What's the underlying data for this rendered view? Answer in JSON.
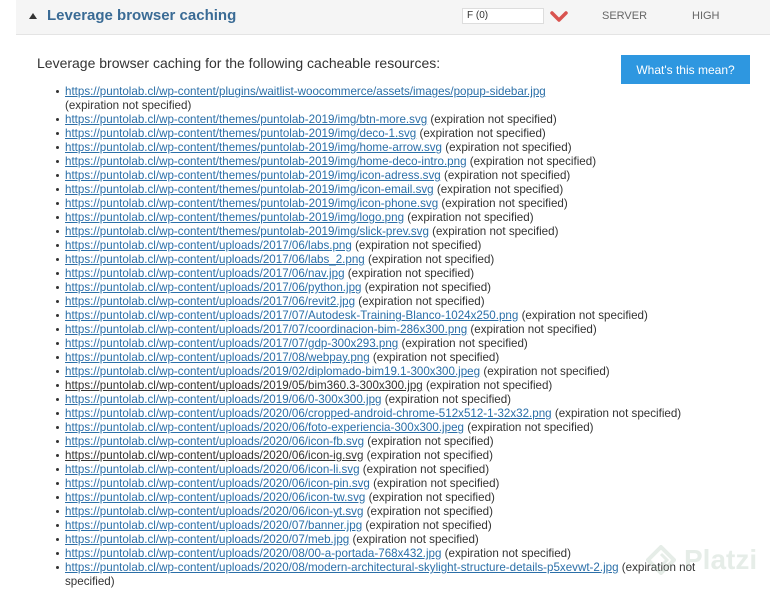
{
  "header": {
    "title": "Leverage browser caching",
    "grade": "F (0)",
    "type": "SERVER",
    "priority": "HIGH",
    "heart_color": "#d9534f"
  },
  "intro": "Leverage browser caching for the following cacheable resources:",
  "help_button": "What's this mean?",
  "resources": [
    {
      "url": "https://puntolab.cl/wp-content/plugins/waitlist-woocommerce/assets/images/popup-sidebar.jpg",
      "note": "(expiration not specified)"
    },
    {
      "url": "https://puntolab.cl/wp-content/themes/puntolab-2019/img/btn-more.svg",
      "note": "(expiration not specified)"
    },
    {
      "url": "https://puntolab.cl/wp-content/themes/puntolab-2019/img/deco-1.svg",
      "note": "(expiration not specified)"
    },
    {
      "url": "https://puntolab.cl/wp-content/themes/puntolab-2019/img/home-arrow.svg",
      "note": "(expiration not specified)"
    },
    {
      "url": "https://puntolab.cl/wp-content/themes/puntolab-2019/img/home-deco-intro.png",
      "note": "(expiration not specified)"
    },
    {
      "url": "https://puntolab.cl/wp-content/themes/puntolab-2019/img/icon-adress.svg",
      "note": "(expiration not specified)"
    },
    {
      "url": "https://puntolab.cl/wp-content/themes/puntolab-2019/img/icon-email.svg",
      "note": "(expiration not specified)"
    },
    {
      "url": "https://puntolab.cl/wp-content/themes/puntolab-2019/img/icon-phone.svg",
      "note": "(expiration not specified)"
    },
    {
      "url": "https://puntolab.cl/wp-content/themes/puntolab-2019/img/logo.png",
      "note": "(expiration not specified)"
    },
    {
      "url": "https://puntolab.cl/wp-content/themes/puntolab-2019/img/slick-prev.svg",
      "note": "(expiration not specified)"
    },
    {
      "url": "https://puntolab.cl/wp-content/uploads/2017/06/labs.png",
      "note": "(expiration not specified)"
    },
    {
      "url": "https://puntolab.cl/wp-content/uploads/2017/06/labs_2.png",
      "note": "(expiration not specified)"
    },
    {
      "url": "https://puntolab.cl/wp-content/uploads/2017/06/nav.jpg",
      "note": "(expiration not specified)"
    },
    {
      "url": "https://puntolab.cl/wp-content/uploads/2017/06/python.jpg",
      "note": "(expiration not specified)"
    },
    {
      "url": "https://puntolab.cl/wp-content/uploads/2017/06/revit2.jpg",
      "note": "(expiration not specified)"
    },
    {
      "url": "https://puntolab.cl/wp-content/uploads/2017/07/Autodesk-Training-Blanco-1024x250.png",
      "note": "(expiration not specified)"
    },
    {
      "url": "https://puntolab.cl/wp-content/uploads/2017/07/coordinacion-bim-286x300.png",
      "note": "(expiration not specified)"
    },
    {
      "url": "https://puntolab.cl/wp-content/uploads/2017/07/gdp-300x293.png",
      "note": "(expiration not specified)"
    },
    {
      "url": "https://puntolab.cl/wp-content/uploads/2017/08/webpay.png",
      "note": "(expiration not specified)"
    },
    {
      "url": "https://puntolab.cl/wp-content/uploads/2019/02/diplomado-bim19.1-300x300.jpeg",
      "note": "(expiration not specified)"
    },
    {
      "url": "https://puntolab.cl/wp-content/uploads/2019/05/bim360.3-300x300.jpg",
      "note": "(expiration not specified)",
      "visited": true
    },
    {
      "url": "https://puntolab.cl/wp-content/uploads/2019/06/0-300x300.jpg",
      "note": "(expiration not specified)"
    },
    {
      "url": "https://puntolab.cl/wp-content/uploads/2020/06/cropped-android-chrome-512x512-1-32x32.png",
      "note": "(expiration not specified)"
    },
    {
      "url": "https://puntolab.cl/wp-content/uploads/2020/06/foto-experiencia-300x300.jpeg",
      "note": "(expiration not specified)"
    },
    {
      "url": "https://puntolab.cl/wp-content/uploads/2020/06/icon-fb.svg",
      "note": "(expiration not specified)"
    },
    {
      "url": "https://puntolab.cl/wp-content/uploads/2020/06/icon-ig.svg",
      "note": "(expiration not specified)",
      "visited": true
    },
    {
      "url": "https://puntolab.cl/wp-content/uploads/2020/06/icon-li.svg",
      "note": "(expiration not specified)"
    },
    {
      "url": "https://puntolab.cl/wp-content/uploads/2020/06/icon-pin.svg",
      "note": "(expiration not specified)"
    },
    {
      "url": "https://puntolab.cl/wp-content/uploads/2020/06/icon-tw.svg",
      "note": "(expiration not specified)"
    },
    {
      "url": "https://puntolab.cl/wp-content/uploads/2020/06/icon-yt.svg",
      "note": "(expiration not specified)"
    },
    {
      "url": "https://puntolab.cl/wp-content/uploads/2020/07/banner.jpg",
      "note": "(expiration not specified)"
    },
    {
      "url": "https://puntolab.cl/wp-content/uploads/2020/07/meb.jpg",
      "note": "(expiration not specified)"
    },
    {
      "url": "https://puntolab.cl/wp-content/uploads/2020/08/00-a-portada-768x432.jpg",
      "note": "(expiration not specified)"
    },
    {
      "url": "https://puntolab.cl/wp-content/uploads/2020/08/modern-architectural-skylight-structure-details-p5xevwt-2.jpg",
      "note": "(expiration not specified)"
    }
  ],
  "watermark": {
    "text": "Platzi",
    "icon": "platzi-logo-icon"
  }
}
